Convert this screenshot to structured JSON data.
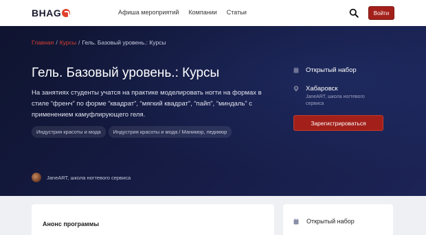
{
  "header": {
    "logo_text": "BHAG",
    "nav": [
      "Афиша мероприятий",
      "Компании",
      "Статьи"
    ],
    "login_label": "Войти",
    "accent_color": "#a3201a"
  },
  "breadcrumb": {
    "home": "Главная",
    "courses": "Курсы",
    "current": "Гель. Базовый уровень.: Курсы"
  },
  "hero": {
    "title": "Гель. Базовый уровень.: Курсы",
    "description": "На занятиях студенты учатся на практике моделировать ногти на формах в стиле “френч” по форме “квадрат”, “мягкий квадрат”, “пайп”, “миндаль” с применением камуфлирующего геля.",
    "tags": [
      "Индустрия красоты и мода",
      "Индустрия красоты и мода / Маникюр, педикюр"
    ],
    "organizer": "JaneART, школа ногтевого сервиса"
  },
  "sidebar": {
    "status": "Открытый набор",
    "city": "Хабаровск",
    "city_sub": "JaneART, школа ногтевого сервиса",
    "register_label": "Зарегистрироваться"
  },
  "cards": {
    "program_title": "Анонс программы",
    "status": "Открытый набор"
  }
}
